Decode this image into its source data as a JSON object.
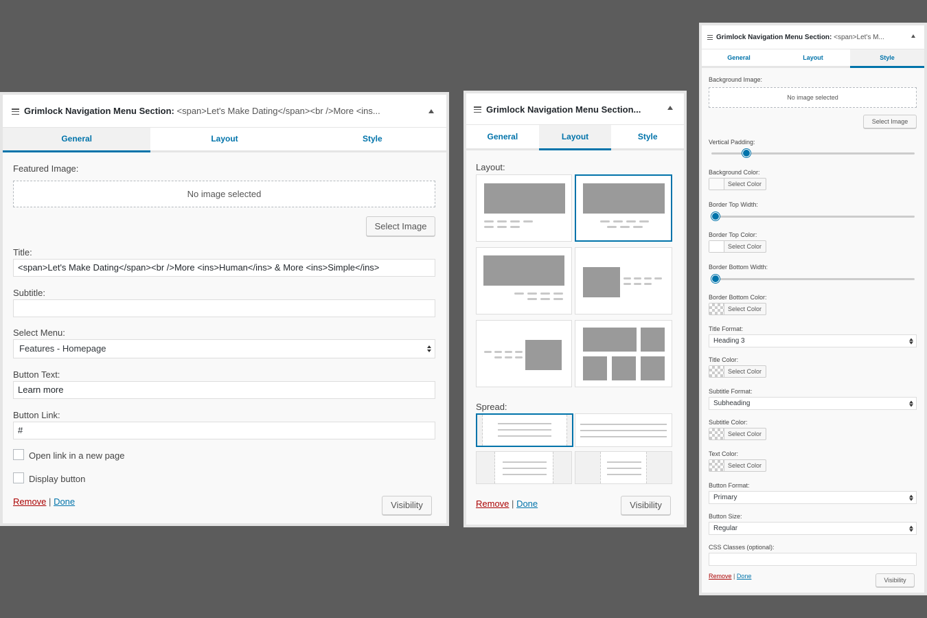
{
  "widget_title": "Grimlock Navigation Menu Section:",
  "widget_title_sub": "<span>Let's Make Dating</span><br />More <ins...",
  "widget_title_short": "Grimlock Navigation Menu Section...",
  "widget_title_sub_short": "<span>Let's M...",
  "tabs": {
    "general": "General",
    "layout": "Layout",
    "style": "Style"
  },
  "general": {
    "featured_image_label": "Featured Image:",
    "no_image": "No image selected",
    "select_image": "Select Image",
    "title_label": "Title:",
    "title_value": "<span>Let's Make Dating</span><br />More <ins>Human</ins> & More <ins>Simple</ins>",
    "subtitle_label": "Subtitle:",
    "subtitle_value": "",
    "menu_label": "Select Menu:",
    "menu_value": "Features - Homepage",
    "button_text_label": "Button Text:",
    "button_text_value": "Learn more",
    "button_link_label": "Button Link:",
    "button_link_value": "#",
    "open_new_page": "Open link in a new page",
    "display_button": "Display button"
  },
  "layout": {
    "layout_label": "Layout:",
    "spread_label": "Spread:"
  },
  "style": {
    "bg_image_label": "Background Image:",
    "no_image": "No image selected",
    "select_image": "Select Image",
    "vpad_label": "Vertical Padding:",
    "bg_color_label": "Background Color:",
    "btw_label": "Border Top Width:",
    "btc_label": "Border Top Color:",
    "bbw_label": "Border Bottom Width:",
    "bbc_label": "Border Bottom Color:",
    "title_format_label": "Title Format:",
    "title_format_value": "Heading 3",
    "title_color_label": "Title Color:",
    "subtitle_format_label": "Subtitle Format:",
    "subtitle_format_value": "Subheading",
    "subtitle_color_label": "Subtitle Color:",
    "text_color_label": "Text Color:",
    "button_format_label": "Button Format:",
    "button_format_value": "Primary",
    "button_size_label": "Button Size:",
    "button_size_value": "Regular",
    "css_label": "CSS Classes (optional):",
    "css_value": "",
    "select_color": "Select Color"
  },
  "actions": {
    "remove": "Remove",
    "sep": "|",
    "done": "Done",
    "visibility": "Visibility"
  }
}
